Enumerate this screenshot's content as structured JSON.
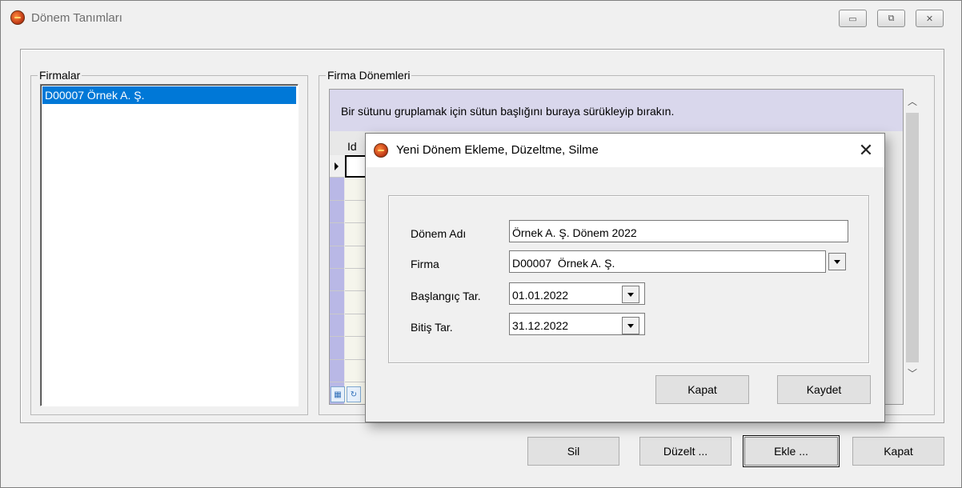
{
  "window": {
    "title": "Dönem Tanımları",
    "controls": {
      "minimize": "▭",
      "restore": "⧉",
      "close": "✕"
    }
  },
  "firmalar": {
    "label": "Firmalar",
    "items": [
      "D00007  Örnek A. Ş."
    ]
  },
  "firma_donemleri": {
    "label": "Firma Dönemleri",
    "group_panel_text": "Bir sütunu gruplamak için sütun başlığını buraya sürükleyip bırakın.",
    "columns": [
      "Id"
    ]
  },
  "bottom_buttons": {
    "sil": "Sil",
    "duzelt": "Düzelt ...",
    "ekle": "Ekle ...",
    "kapat": "Kapat"
  },
  "dialog": {
    "title": "Yeni Dönem Ekleme, Düzeltme, Silme",
    "close_glyph": "✕",
    "fields": {
      "donem_adi": {
        "label": "Dönem Adı",
        "value": "Örnek A. Ş. Dönem 2022"
      },
      "firma": {
        "label": "Firma",
        "value": "D00007  Örnek A. Ş."
      },
      "baslangic": {
        "label": "Başlangıç Tar.",
        "value": "01.01.2022"
      },
      "bitis": {
        "label": "Bitiş Tar.",
        "value": "31.12.2022"
      }
    },
    "buttons": {
      "kapat": "Kapat",
      "kaydet": "Kaydet"
    }
  },
  "colors": {
    "selection": "#0078d7",
    "group_panel": "#d9d7ec",
    "indicator": "#b9b8e6"
  }
}
